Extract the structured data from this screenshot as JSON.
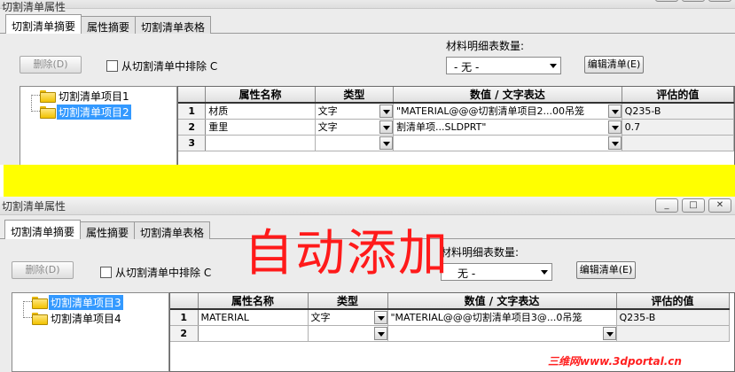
{
  "top_window": {
    "title": "切割清单属性",
    "window_buttons": [
      "_",
      "□",
      "✕"
    ],
    "tabs": [
      "切割清单摘要",
      "属性摘要",
      "切割清单表格"
    ],
    "delete_button": "删除(D)",
    "exclude_checkbox": "从切割清单中排除 C",
    "bom_qty_label": "材料明细表数量:",
    "bom_qty_value": "- 无 -",
    "edit_list_button": "编辑清单(E)",
    "tree_items": [
      "切割清单项目1",
      "切割清单项目2"
    ],
    "selected_tree_item": "切割清单项目2",
    "columns": [
      "属性名称",
      "类型",
      "数值 / 文字表达",
      "评估的值"
    ],
    "rows": [
      {
        "num": "1",
        "name": "材质",
        "type": "文字",
        "expr": "\"MATERIAL@@@切割清单项目2...00吊笼",
        "eval": "Q235-B"
      },
      {
        "num": "2",
        "name": "重里",
        "type": "文字",
        "expr": "割清单项...SLDPRT\"",
        "eval": "0.7"
      },
      {
        "num": "3",
        "name": "",
        "type": "",
        "expr": "",
        "eval": ""
      }
    ]
  },
  "bottom_window": {
    "title": "切割清单属性",
    "window_buttons": [
      "_",
      "□",
      "✕"
    ],
    "tabs": [
      "切割清单摘要",
      "属性摘要",
      "切割清单表格"
    ],
    "delete_button": "删除(D)",
    "exclude_checkbox": "从切割清单中排除 C",
    "bom_qty_label": "材料明细表数量:",
    "bom_qty_value": "无 -",
    "edit_list_button": "编辑清单(E)",
    "tree_items": [
      "切割清单项目3",
      "切割清单项目4"
    ],
    "selected_tree_item": "切割清单项目3",
    "columns": [
      "属性名称",
      "类型",
      "数值 / 文字表达",
      "评估的值"
    ],
    "rows": [
      {
        "num": "1",
        "name": "MATERIAL",
        "type": "文字",
        "expr": "\"MATERIAL@@@切割清单项目3@...0吊笼",
        "eval": "Q235-B"
      },
      {
        "num": "2",
        "name": "",
        "type": "",
        "expr": "",
        "eval": ""
      }
    ]
  },
  "annotation": "自动添加",
  "watermark": "三维网www.3dportal.cn",
  "colors": {
    "highlight": "#ff1a1a",
    "band": "#ffff00",
    "selection": "#3399ff"
  }
}
